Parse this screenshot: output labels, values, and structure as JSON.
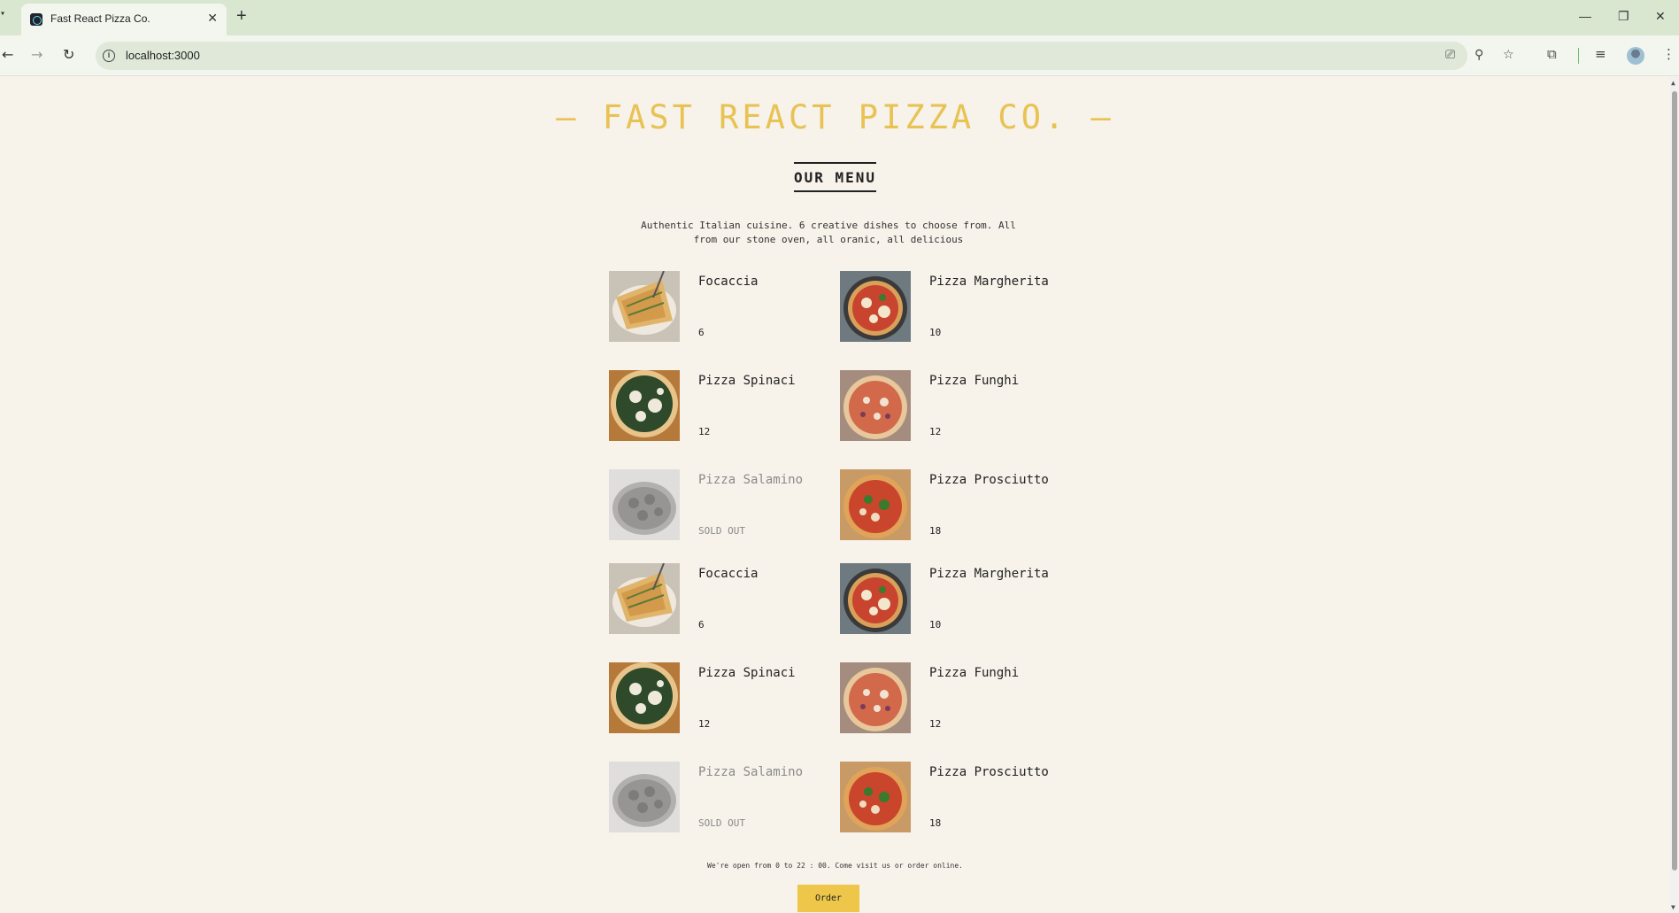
{
  "browser": {
    "tab_title": "Fast React Pizza Co.",
    "url": "localhost:3000"
  },
  "header": {
    "brand": "— FAST REACT PIZZA CO. —"
  },
  "menu": {
    "title": "OUR MENU",
    "intro": "Authentic Italian cuisine. 6 creative dishes to choose from. All from our stone oven, all oranic, all delicious",
    "items": [
      {
        "name": "Focaccia",
        "price": "6",
        "sold_out": false,
        "image": "focaccia-image"
      },
      {
        "name": "Pizza Margherita",
        "price": "10",
        "sold_out": false,
        "image": "margherita-image"
      },
      {
        "name": "Pizza Spinaci",
        "price": "12",
        "sold_out": false,
        "image": "spinaci-image"
      },
      {
        "name": "Pizza Funghi",
        "price": "12",
        "sold_out": false,
        "image": "funghi-image"
      },
      {
        "name": "Pizza Salamino",
        "price": "SOLD OUT",
        "sold_out": true,
        "image": "salamino-image"
      },
      {
        "name": "Pizza Prosciutto",
        "price": "18",
        "sold_out": false,
        "image": "prosciutto-image"
      },
      {
        "name": "Focaccia",
        "price": "6",
        "sold_out": false,
        "image": "focaccia-image"
      },
      {
        "name": "Pizza Margherita",
        "price": "10",
        "sold_out": false,
        "image": "margherita-image"
      },
      {
        "name": "Pizza Spinaci",
        "price": "12",
        "sold_out": false,
        "image": "spinaci-image"
      },
      {
        "name": "Pizza Funghi",
        "price": "12",
        "sold_out": false,
        "image": "funghi-image"
      },
      {
        "name": "Pizza Salamino",
        "price": "SOLD OUT",
        "sold_out": true,
        "image": "salamino-image"
      },
      {
        "name": "Pizza Prosciutto",
        "price": "18",
        "sold_out": false,
        "image": "prosciutto-image"
      }
    ]
  },
  "footer": {
    "note": "We're open from 0 to 22 : 00. Come visit us or order online.",
    "order_label": "Order"
  },
  "colors": {
    "brand_yellow": "#e8c253",
    "button_yellow": "#edc64a",
    "page_bg": "#f7f2ea"
  }
}
